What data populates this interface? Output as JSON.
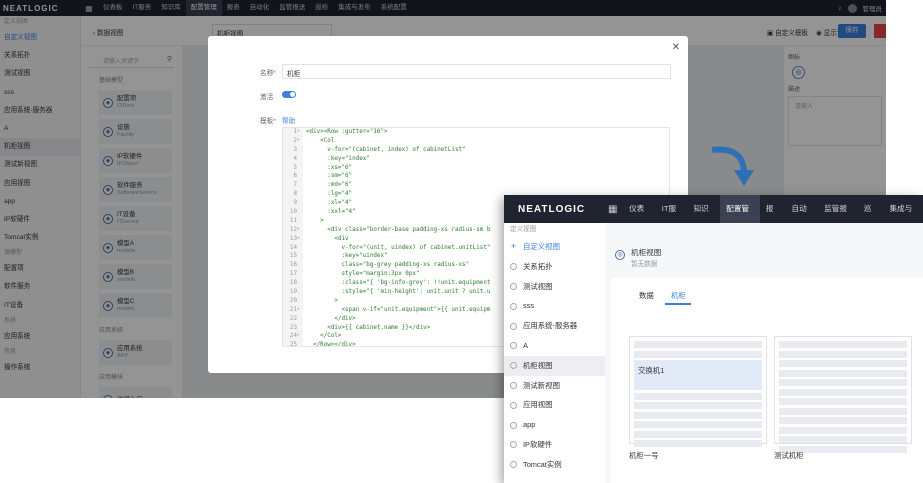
{
  "app": {
    "logo": "NEATLOGIC"
  },
  "topnav": {
    "items": [
      "仪表板",
      "IT服务",
      "知识库",
      "配置管理",
      "报表",
      "自动化",
      "监管报送",
      "巡检",
      "集成与发布",
      "系统配置"
    ],
    "active_index": 3,
    "user_text": "管理员"
  },
  "subbar": {
    "back_label": "数据视图",
    "name_value": "机柜视图",
    "custom_template_label": "自定义模板",
    "display_settings_label": "显示设置",
    "save_label": "保存"
  },
  "sidebar": {
    "items": [
      {
        "label": "定义视图",
        "type": "muted"
      },
      {
        "label": "自定义视图",
        "type": "link"
      },
      {
        "label": "关系拓扑",
        "type": "normal"
      },
      {
        "label": "测试视图",
        "type": "normal"
      },
      {
        "label": "sss",
        "type": "normal"
      },
      {
        "label": "应用系统-服务器",
        "type": "normal"
      },
      {
        "label": "A",
        "type": "normal"
      },
      {
        "label": "机柜视图",
        "type": "selected"
      },
      {
        "label": "测试新视图",
        "type": "normal"
      },
      {
        "label": "应用视图",
        "type": "normal"
      },
      {
        "label": "app",
        "type": "normal"
      },
      {
        "label": "IP软硬件",
        "type": "normal"
      },
      {
        "label": "Tomcat实例",
        "type": "normal"
      },
      {
        "label": "源模型",
        "type": "muted"
      },
      {
        "label": "配置项",
        "type": "normal"
      },
      {
        "label": "软件服务",
        "type": "normal"
      },
      {
        "label": "IT设备",
        "type": "normal"
      },
      {
        "label": "系统",
        "type": "muted"
      },
      {
        "label": "应用系统",
        "type": "normal"
      },
      {
        "label": "信息",
        "type": "muted"
      },
      {
        "label": "操作系统",
        "type": "normal"
      }
    ]
  },
  "palette": {
    "search_placeholder": "请输入关键字",
    "groups": [
      {
        "title": "基础模型",
        "cards": [
          {
            "title": "配置项",
            "sub": "CIRoot"
          },
          {
            "title": "设施",
            "sub": "Facility"
          },
          {
            "title": "IP软硬件",
            "sub": "IPObject"
          },
          {
            "title": "软件服务",
            "sub": "SoftwareService"
          },
          {
            "title": "IT设备",
            "sub": "ITDevice"
          },
          {
            "title": "模型A",
            "sub": "modela"
          },
          {
            "title": "模型B",
            "sub": "modelb"
          },
          {
            "title": "模型C",
            "sub": "modelc"
          }
        ]
      },
      {
        "title": "应用系统",
        "cards": [
          {
            "title": "应用系统",
            "sub": "APP"
          }
        ]
      },
      {
        "title": "应用模块",
        "cards": [
          {
            "title": "访问入口",
            "sub": ""
          }
        ]
      }
    ]
  },
  "props": {
    "icon_label": "图标",
    "desc_label": "描述",
    "desc_placeholder": "请输入"
  },
  "modal": {
    "name_label": "名称",
    "name_value": "机柜",
    "active_label": "激活",
    "active_on": true,
    "template_label": "模板",
    "help_label": "帮助",
    "code_lines": [
      {
        "n": "1",
        "f": "▾",
        "t": "<div><Row :gutter=\"16\">"
      },
      {
        "n": "2",
        "f": "▾",
        "t": "    <Col"
      },
      {
        "n": "3",
        "f": "",
        "t": "      v-for=\"(cabinet, index) of cabinetList\""
      },
      {
        "n": "4",
        "f": "",
        "t": "      :key=\"index\""
      },
      {
        "n": "5",
        "f": "",
        "t": "      :xs=\"6\""
      },
      {
        "n": "6",
        "f": "",
        "t": "      :sm=\"6\""
      },
      {
        "n": "7",
        "f": "",
        "t": "      :md=\"6\""
      },
      {
        "n": "8",
        "f": "",
        "t": "      :lg=\"4\""
      },
      {
        "n": "9",
        "f": "",
        "t": "      :xl=\"4\""
      },
      {
        "n": "10",
        "f": "",
        "t": "      :xxl=\"4\""
      },
      {
        "n": "11",
        "f": "",
        "t": "    >"
      },
      {
        "n": "12",
        "f": "▾",
        "t": "      <div class=\"border-base padding-xs radius-sm b"
      },
      {
        "n": "13",
        "f": "▾",
        "t": "        <div"
      },
      {
        "n": "14",
        "f": "",
        "t": "          v-for=\"(unit, uindex) of cabinet.unitList\""
      },
      {
        "n": "15",
        "f": "",
        "t": "          :key=\"uindex\""
      },
      {
        "n": "16",
        "f": "",
        "t": "          class=\"bg-grey padding-xs radius-xs\""
      },
      {
        "n": "17",
        "f": "",
        "t": "          style=\"margin:3px 0px\""
      },
      {
        "n": "18",
        "f": "",
        "t": "          :class=\"{ 'bg-info-grey': !!unit.equipment"
      },
      {
        "n": "19",
        "f": "",
        "t": "          :style=\"{ 'min-height': unit.unit ? unit.u"
      },
      {
        "n": "20",
        "f": "",
        "t": "        >"
      },
      {
        "n": "21",
        "f": "▾",
        "t": "          <span v-if=\"unit.equipment\">{{ unit.equipm"
      },
      {
        "n": "22",
        "f": "",
        "t": "        </div>"
      },
      {
        "n": "23",
        "f": "",
        "t": "      <div>{{ cabinet.name }}</div>"
      },
      {
        "n": "24",
        "f": "▾",
        "t": "    </Col>"
      },
      {
        "n": "25",
        "f": "",
        "t": "  </Row></div>"
      }
    ]
  },
  "zoom": {
    "logo": "NEATLOGIC",
    "menu": [
      "仪表板",
      "IT服务",
      "知识库",
      "配置管理",
      "报表",
      "自动化",
      "监管报送",
      "巡检",
      "集成与发"
    ],
    "active_index": 3,
    "sidebar": {
      "section": "定义视图",
      "items": [
        {
          "label": "自定义视图",
          "type": "link",
          "icon": "plus-icon"
        },
        {
          "label": "关系拓扑",
          "type": "normal",
          "icon": "circle-icon"
        },
        {
          "label": "测试视图",
          "type": "normal",
          "icon": "circle-icon"
        },
        {
          "label": "sss",
          "type": "normal",
          "icon": "circle-icon"
        },
        {
          "label": "应用系统-服务器",
          "type": "normal",
          "icon": "circle-icon"
        },
        {
          "label": "A",
          "type": "normal",
          "icon": "circle-icon"
        },
        {
          "label": "机柜视图",
          "type": "selected",
          "icon": "circle-icon"
        },
        {
          "label": "测试新视图",
          "type": "normal",
          "icon": "circle-icon"
        },
        {
          "label": "应用视图",
          "type": "normal",
          "icon": "circle-icon"
        },
        {
          "label": "app",
          "type": "normal",
          "icon": "circle-icon"
        },
        {
          "label": "IP软硬件",
          "type": "normal",
          "icon": "circle-icon"
        },
        {
          "label": "Tomcat实例",
          "type": "normal",
          "icon": "circle-icon"
        }
      ]
    },
    "title": "机柜视图",
    "subtitle": "暂无数据",
    "tabs": [
      "数据",
      "机柜"
    ],
    "active_tab": 1,
    "cabinets": [
      {
        "name": "机柜一号",
        "equipment": "交换机1"
      },
      {
        "name": "测试机柜",
        "equipment": ""
      }
    ]
  },
  "colors": {
    "accent": "#3d7ee0",
    "topbar": "#1f2430",
    "danger": "#e64545"
  }
}
